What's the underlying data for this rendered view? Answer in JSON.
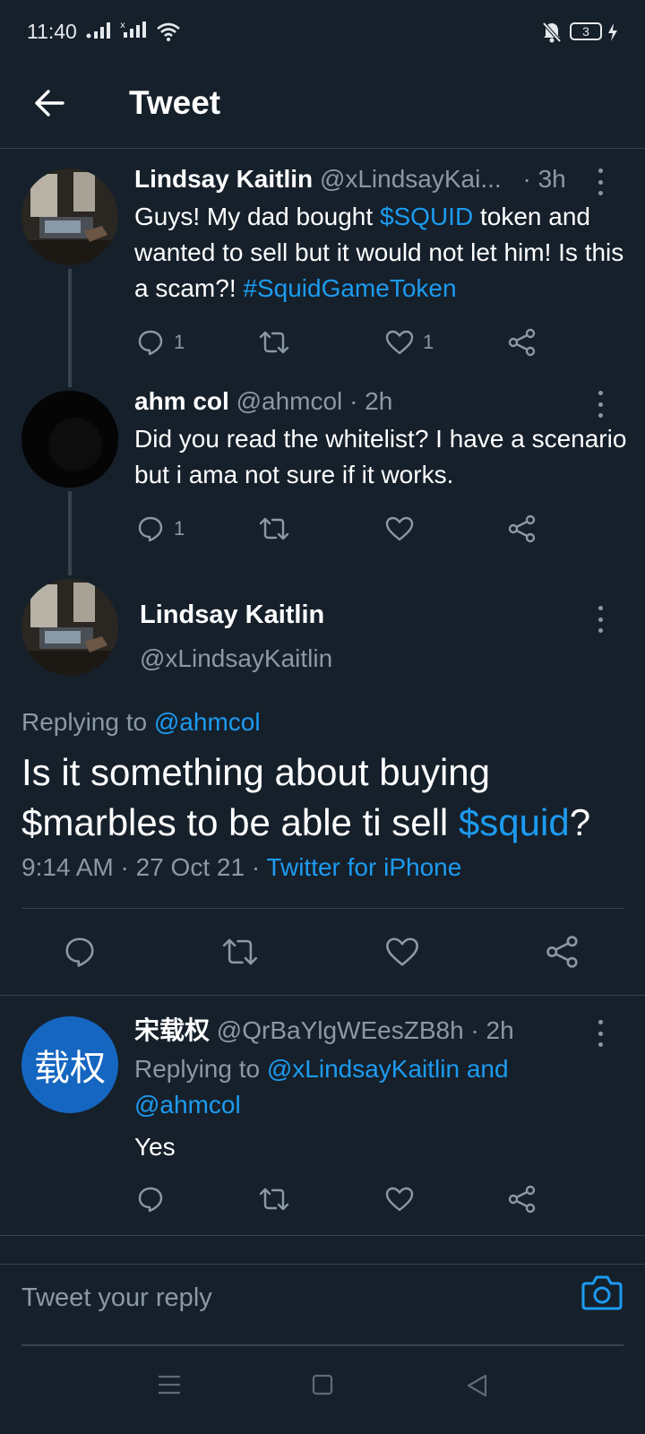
{
  "status_bar": {
    "time": "11:40",
    "battery": "3",
    "icons": [
      "signal-icon",
      "signal-icon",
      "wifi-icon",
      "bell-off-icon",
      "battery-icon",
      "charging-icon"
    ]
  },
  "header": {
    "title": "Tweet",
    "back_icon": "arrow-left-icon"
  },
  "thread": [
    {
      "name": "Lindsay Kaitlin",
      "handle": "@xLindsayKai...",
      "dot": "·",
      "age": "3h",
      "text_parts": [
        {
          "t": "Guys! My dad bought ",
          "link": false
        },
        {
          "t": "$SQUID",
          "link": true
        },
        {
          "t": " token and wanted to sell but it would not let him! Is this a scam?! ",
          "link": false
        },
        {
          "t": "#SquidGameToken",
          "link": true
        }
      ],
      "reply_count": "1",
      "retweet_count": "",
      "like_count": "1"
    },
    {
      "name": "ahm col",
      "handle": "@ahmcol",
      "dot": "·",
      "age": "2h",
      "text": "Did you read the whitelist? I have a scenario but i ama not sure if it works.",
      "reply_count": "1",
      "retweet_count": "",
      "like_count": ""
    }
  ],
  "main_tweet": {
    "name": "Lindsay Kaitlin",
    "handle": "@xLindsayKaitlin",
    "replying_prefix": "Replying to ",
    "replying_to": "@ahmcol",
    "text_before": "Is it something about buying $marbles to be able ti sell ",
    "text_link": "$squid",
    "text_after": "?",
    "time": "9:14 AM",
    "date": "27 Oct 21",
    "sep": "·",
    "source": "Twitter for iPhone"
  },
  "reply": {
    "avatar_text": "载权",
    "name": "宋载权",
    "handle": "@QrBaYlgWEesZB8h",
    "dot": "·",
    "age": "2h",
    "replying_prefix": "Replying to ",
    "replying_to": "@xLindsayKaitlin and @ahmcol",
    "text": "Yes"
  },
  "composer": {
    "placeholder": "Tweet your reply",
    "camera_icon": "camera-icon"
  },
  "colors": {
    "background": "#15202b",
    "link": "#1d9bf0",
    "secondary_text": "#8b98a5",
    "divider": "#38444d"
  }
}
